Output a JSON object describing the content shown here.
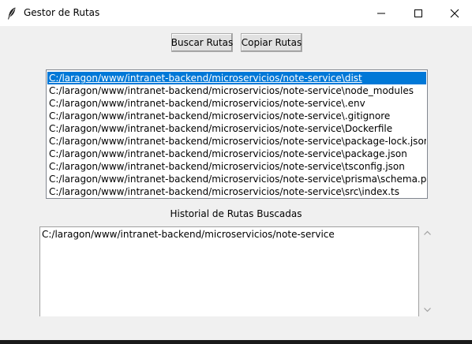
{
  "window": {
    "title": "Gestor de Rutas",
    "icon": "feather-icon",
    "controls": [
      "minimize-icon",
      "maximize-icon",
      "close-icon"
    ]
  },
  "toolbar": {
    "buscar_label": "Buscar Rutas",
    "copiar_label": "Copiar Rutas"
  },
  "results": {
    "items": [
      "C:/laragon/www/intranet-backend/microservicios/note-service\\dist",
      "C:/laragon/www/intranet-backend/microservicios/note-service\\node_modules",
      "C:/laragon/www/intranet-backend/microservicios/note-service\\.env",
      "C:/laragon/www/intranet-backend/microservicios/note-service\\.gitignore",
      "C:/laragon/www/intranet-backend/microservicios/note-service\\Dockerfile",
      "C:/laragon/www/intranet-backend/microservicios/note-service\\package-lock.json",
      "C:/laragon/www/intranet-backend/microservicios/note-service\\package.json",
      "C:/laragon/www/intranet-backend/microservicios/note-service\\tsconfig.json",
      "C:/laragon/www/intranet-backend/microservicios/note-service\\prisma\\schema.prisma",
      "C:/laragon/www/intranet-backend/microservicios/note-service\\src\\index.ts"
    ],
    "selected_index": 0,
    "selection_color": "#0078d7"
  },
  "history": {
    "label": "Historial de Rutas Buscadas",
    "text": "C:/laragon/www/intranet-backend/microservicios/note-service"
  }
}
